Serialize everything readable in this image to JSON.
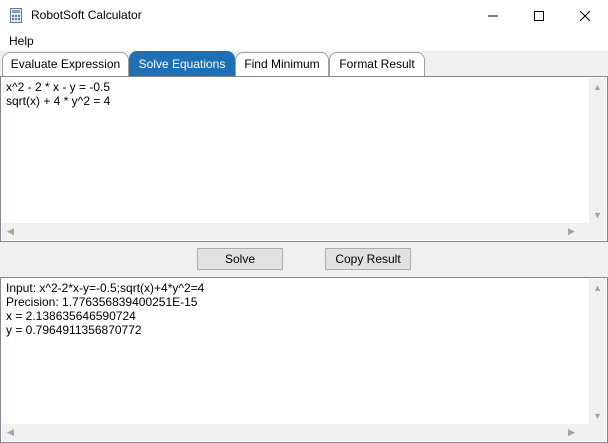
{
  "window": {
    "title": "RobotSoft Calculator",
    "icon": "calculator-icon",
    "controls": [
      "minimize-icon",
      "maximize-icon",
      "close-icon"
    ]
  },
  "menu": {
    "help_label": "Help"
  },
  "tabs": [
    {
      "label": "Evaluate Expression",
      "active": false
    },
    {
      "label": "Solve Equations",
      "active": true
    },
    {
      "label": "Find Minimum",
      "active": false
    },
    {
      "label": "Format Result",
      "active": false
    }
  ],
  "input": {
    "lines": [
      "x^2 - 2 * x - y = -0.5",
      "sqrt(x) + 4 * y^2 = 4"
    ]
  },
  "buttons": {
    "solve_label": "Solve",
    "copy_label": "Copy Result"
  },
  "output": {
    "lines": [
      "Input: x^2-2*x-y=-0.5;sqrt(x)+4*y^2=4",
      "Precision: 1.776356839400251E-15",
      "x = 2.138635646590724",
      "y = 0.7964911356870772"
    ]
  },
  "colors": {
    "active_tab": "#1e6fb4",
    "window_bg": "#f0f0f0"
  }
}
